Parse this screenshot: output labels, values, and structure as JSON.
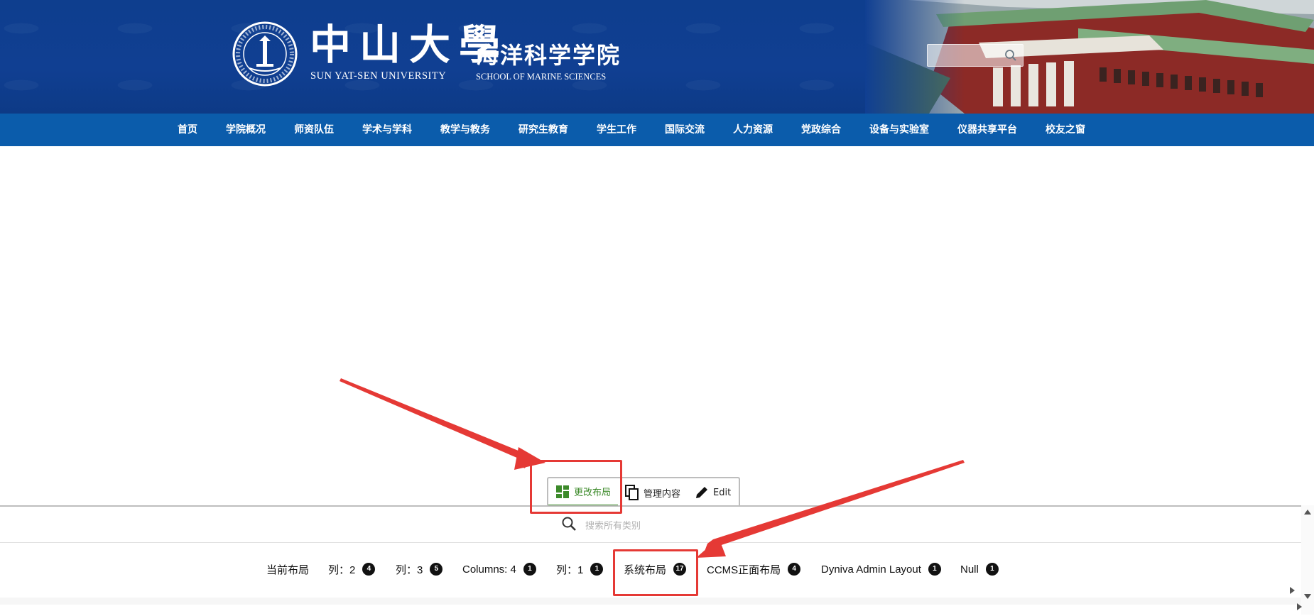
{
  "header": {
    "university_cn": "中山大學",
    "university_en": "SUN  YAT-SEN UNIVERSITY",
    "department_cn": "海洋科学学院",
    "department_en": "SCHOOL OF MARINE SCIENCES",
    "search_placeholder": "",
    "search_icon": "search-icon",
    "seal_icon": "university-seal-icon"
  },
  "nav": {
    "items": [
      "首页",
      "学院概况",
      "师资队伍",
      "学术与学科",
      "教学与教务",
      "研究生教育",
      "学生工作",
      "国际交流",
      "人力资源",
      "党政综合",
      "设备与实验室",
      "仪器共享平台",
      "校友之窗"
    ]
  },
  "toolbar": {
    "tabs": [
      {
        "label": "更改布局",
        "icon": "layout-grid-icon",
        "active": true
      },
      {
        "label": "管理内容",
        "icon": "copy-icon",
        "active": false
      },
      {
        "label": "Edit",
        "icon": "pencil-icon",
        "active": false
      }
    ]
  },
  "panel": {
    "search_placeholder": "搜索所有类别",
    "categories": [
      {
        "label": "当前布局",
        "count": null
      },
      {
        "label": "列：2",
        "count": "4"
      },
      {
        "label": "列：3",
        "count": "5"
      },
      {
        "label": "Columns: 4",
        "count": "1"
      },
      {
        "label": "列：1",
        "count": "1"
      },
      {
        "label": "系统布局",
        "count": "17"
      },
      {
        "label": "CCMS正面布局",
        "count": "4"
      },
      {
        "label": "Dyniva Admin Layout",
        "count": "1"
      },
      {
        "label": "Null",
        "count": "1"
      }
    ]
  },
  "colors": {
    "banner_blue": "#103f92",
    "nav_blue": "#0b5cab",
    "annotation_red": "#e53935",
    "active_tab_green": "#3c8a2a"
  }
}
